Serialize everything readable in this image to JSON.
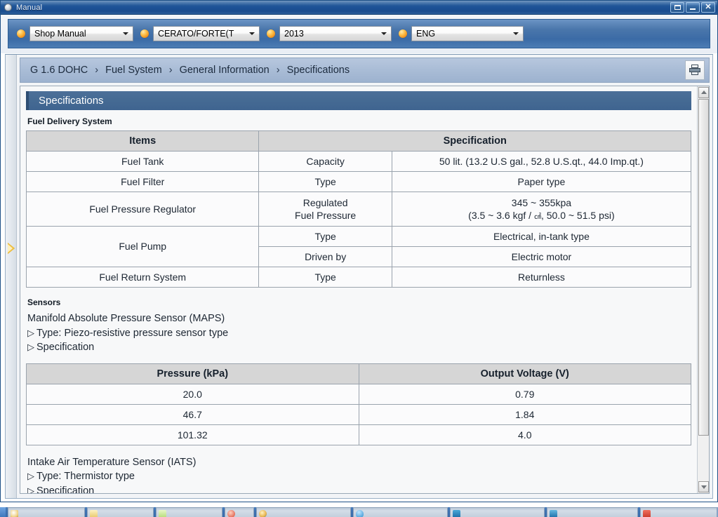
{
  "window": {
    "title": "Manual",
    "icon": "oval-app-icon",
    "buttons": {
      "restore_label": "Restore",
      "minimize_label": "Minimize",
      "close_label": "Close"
    }
  },
  "selector_bar": {
    "selectors": [
      {
        "name": "manual-type",
        "value": "Shop Manual",
        "bullet": "orange-orb"
      },
      {
        "name": "vehicle-model",
        "value": "CERATO/FORTE(T",
        "bullet": "orange-orb"
      },
      {
        "name": "model-year",
        "value": "2013",
        "bullet": "orange-orb"
      },
      {
        "name": "language",
        "value": "ENG",
        "bullet": "orange-orb"
      }
    ]
  },
  "breadcrumb": {
    "items": [
      "G 1.6 DOHC",
      "Fuel System",
      "General Information",
      "Specifications"
    ],
    "separator": "›",
    "print_icon": "printer-icon"
  },
  "document": {
    "section_header": "Specifications",
    "fuel_delivery": {
      "label": "Fuel Delivery System",
      "headers": [
        "Items",
        "Specification"
      ],
      "rows": [
        {
          "item": "Fuel Tank",
          "rowspan": 1,
          "sub": "Capacity",
          "value": "50 lit. (13.2 U.S gal., 52.8 U.S.qt., 44.0 Imp.qt.)"
        },
        {
          "item": "Fuel Filter",
          "rowspan": 1,
          "sub": "Type",
          "value": "Paper type"
        },
        {
          "item": "Fuel Pressure Regulator",
          "rowspan": 1,
          "sub": "Regulated\nFuel Pressure",
          "sub_line1": "Regulated",
          "sub_line2": "Fuel Pressure",
          "value_line1": "345 ~ 355kpa",
          "value_line2_pre": "(3.5 ~ 3.6 kgf / ",
          "value_line2_sup": "㎠",
          "value_line2_post": ", 50.0 ~ 51.5 psi)"
        },
        {
          "item": "Fuel Pump",
          "rowspan": 2,
          "sub": "Type",
          "value": "Electrical, in-tank type"
        },
        {
          "item": "",
          "rowspan": 0,
          "sub": "Driven by",
          "value": "Electric motor"
        },
        {
          "item": "Fuel Return System",
          "rowspan": 1,
          "sub": "Type",
          "value": "Returnless"
        }
      ]
    },
    "sensors": {
      "label": "Sensors",
      "maps": {
        "title": "Manifold Absolute Pressure Sensor (MAPS)",
        "bullet": "▷",
        "type_line": "Type: Piezo-resistive pressure sensor type",
        "spec_line": "Specification",
        "table": {
          "headers": [
            "Pressure (kPa)",
            "Output Voltage (V)"
          ],
          "rows": [
            [
              "20.0",
              "0.79"
            ],
            [
              "46.7",
              "1.84"
            ],
            [
              "101.32",
              "4.0"
            ]
          ]
        }
      },
      "iats": {
        "title": "Intake Air Temperature Sensor (IATS)",
        "bullet": "▷",
        "type_line": "Type: Thermistor type",
        "spec_line": "Specification"
      }
    }
  },
  "scrollbar": {
    "up_label": "Scroll up",
    "down_label": "Scroll down"
  },
  "taskbar": {
    "buttons": [
      {
        "name": "taskbar-item-1",
        "color": "#f0d48a"
      },
      {
        "name": "taskbar-item-2",
        "color": "#f5e6b0"
      },
      {
        "name": "taskbar-item-3",
        "color": "#cfe8a0"
      },
      {
        "name": "taskbar-item-4",
        "color": "#e8b24a"
      },
      {
        "name": "taskbar-item-5",
        "color": "#4fa9e0"
      },
      {
        "name": "taskbar-item-6",
        "color": "#2e7fb8"
      },
      {
        "name": "taskbar-item-7",
        "color": "#2e7fb8"
      },
      {
        "name": "taskbar-item-8",
        "color": "#d84a3a"
      }
    ],
    "tray_text": "•••"
  },
  "colors": {
    "title_bar": "#1d5296",
    "accent_orange": "#f0a018",
    "section_header_blue": "#456a93",
    "breadcrumb_blue": "#a9bcd6"
  }
}
